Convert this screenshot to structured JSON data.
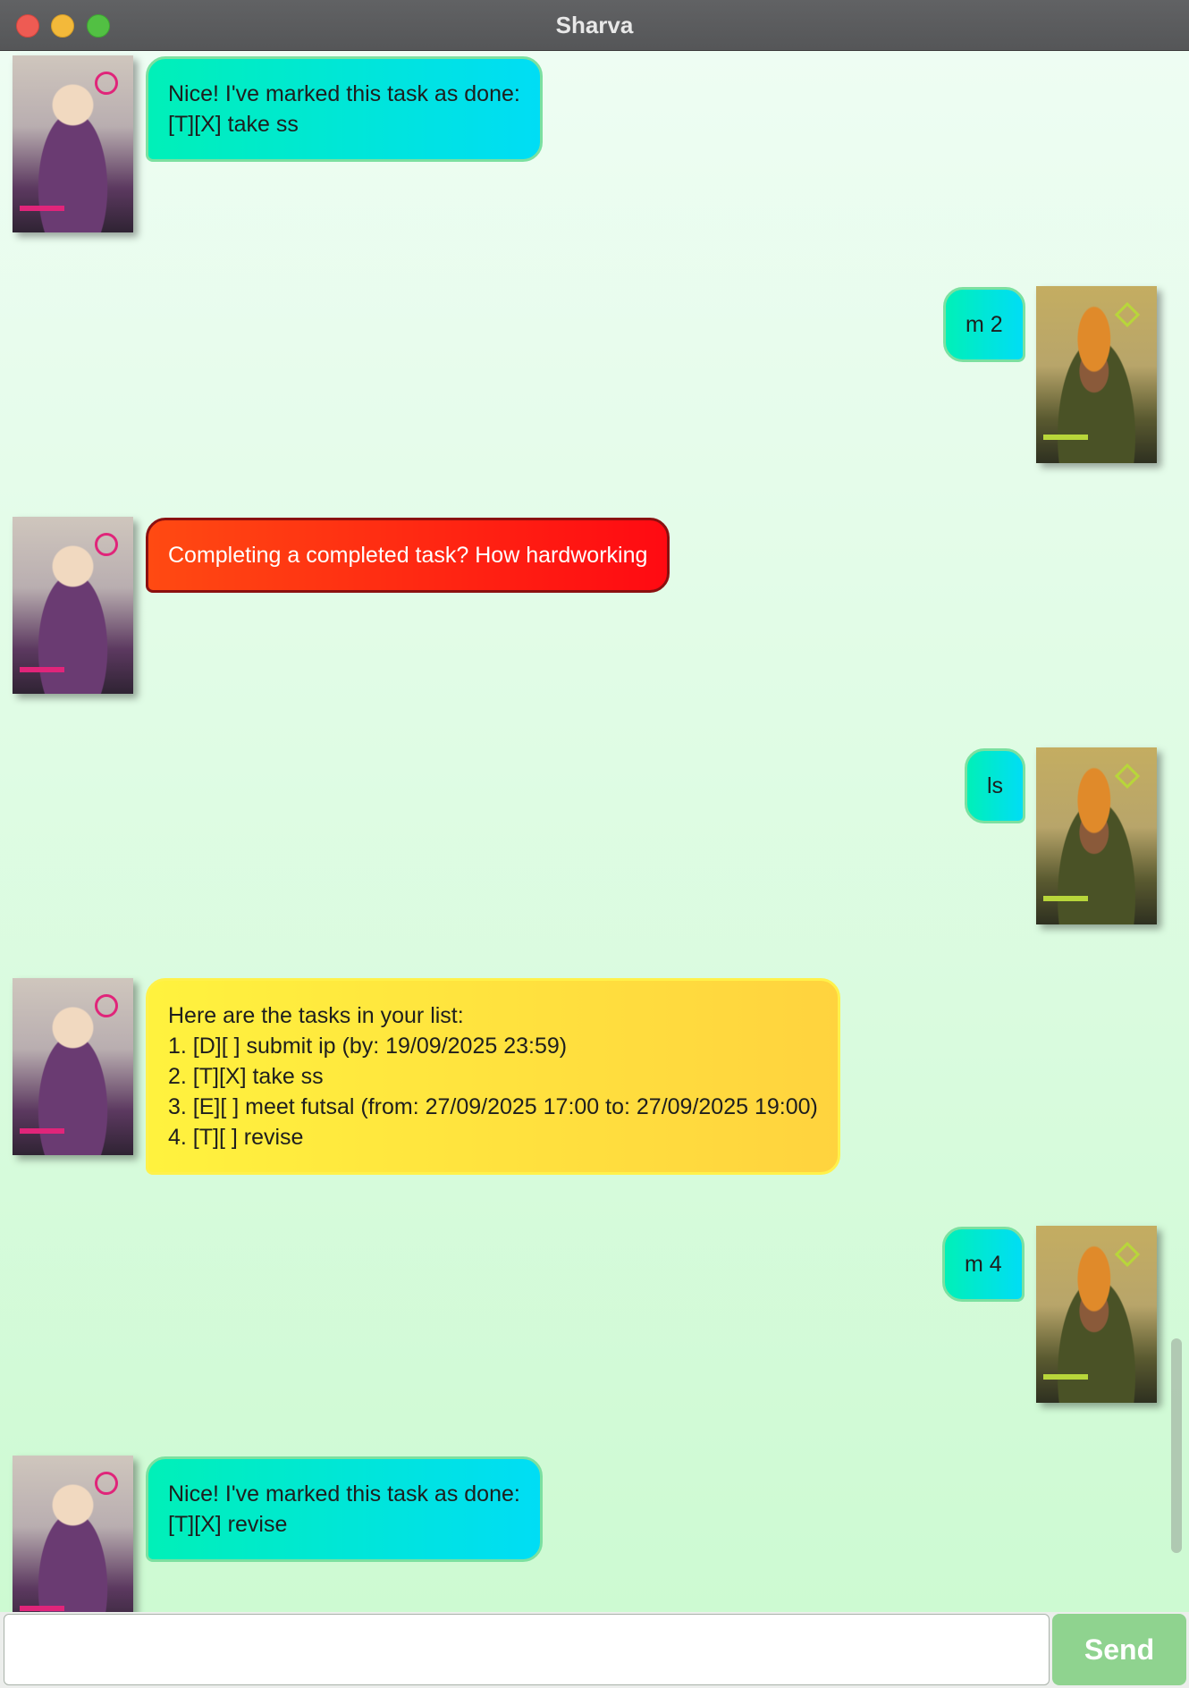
{
  "window": {
    "title": "Sharva"
  },
  "messages": [
    {
      "sender": "bot",
      "style": "cyan",
      "lines": [
        "Nice! I've marked this task as done:",
        "[T][X] take ss"
      ]
    },
    {
      "sender": "user",
      "style": "cyan",
      "lines": [
        "m 2"
      ]
    },
    {
      "sender": "bot",
      "style": "red",
      "lines": [
        "Completing a completed task? How hardworking"
      ]
    },
    {
      "sender": "user",
      "style": "cyan",
      "lines": [
        "ls"
      ]
    },
    {
      "sender": "bot",
      "style": "yellow",
      "lines": [
        "Here are the tasks in your list:",
        "1. [D][ ] submit ip (by: 19/09/2025 23:59)",
        "2. [T][X] take ss",
        "3. [E][ ] meet futsal (from: 27/09/2025 17:00 to: 27/09/2025 19:00)",
        "4. [T][ ] revise"
      ]
    },
    {
      "sender": "user",
      "style": "cyan",
      "lines": [
        "m 4"
      ]
    },
    {
      "sender": "bot",
      "style": "cyan",
      "lines": [
        "Nice! I've marked this task as done:",
        "[T][X] revise"
      ]
    }
  ],
  "input": {
    "value": "",
    "placeholder": ""
  },
  "send_button": {
    "label": "Send"
  },
  "colors": {
    "cyan_bubble": "#00e6d8",
    "red_bubble": "#ff2a12",
    "yellow_bubble": "#ffe23e",
    "send_button": "#8fd38f"
  }
}
